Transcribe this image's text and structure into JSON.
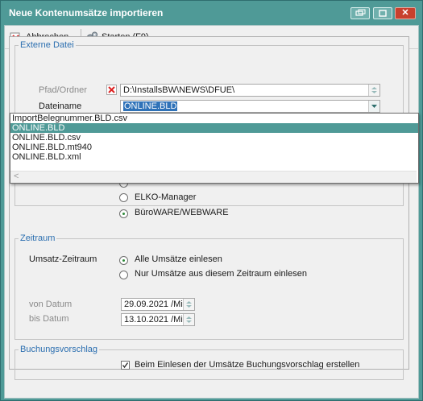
{
  "window": {
    "title": "Neue Kontenumsätze importieren"
  },
  "toolbar": {
    "cancel_label": "Abbrechen",
    "start_label": "Starten (F9)"
  },
  "external_file": {
    "legend": "Externe Datei",
    "path_label": "Pfad/Ordner",
    "path_value": "D:\\InstallsBW\\NEWS\\DFUE\\",
    "filename_label": "Dateiname",
    "filename_value": "ONLINE.BLD",
    "dropdown_options": [
      "ImportBelegnummer.BLD.csv",
      "ONLINE.BLD",
      "ONLINE.BLD.csv",
      "ONLINE.BLD.mt940",
      "ONLINE.BLD.xml"
    ],
    "selected_option": "ONLINE.BLD",
    "format_options": [
      "ELKO-Manager",
      "BüroWARE/WEBWARE"
    ],
    "format_selected": "BüroWARE/WEBWARE"
  },
  "period": {
    "legend": "Zeitraum",
    "label": "Umsatz-Zeitraum",
    "options": [
      "Alle Umsätze einlesen",
      "Nur Umsätze aus diesem Zeitraum einlesen"
    ],
    "selected": "Alle Umsätze einlesen",
    "from_label": "von Datum",
    "from_value": "29.09.2021 /Mi",
    "to_label": "bis Datum",
    "to_value": "13.10.2021 /Mi"
  },
  "booking": {
    "legend": "Buchungsvorschlag",
    "checkbox_label": "Beim Einlesen der Umsätze Buchungsvorschlag erstellen",
    "checked": true
  },
  "colors": {
    "title_bar": "#4f9a97",
    "accent_blue": "#2c6fb0",
    "close_red": "#c8402d"
  }
}
